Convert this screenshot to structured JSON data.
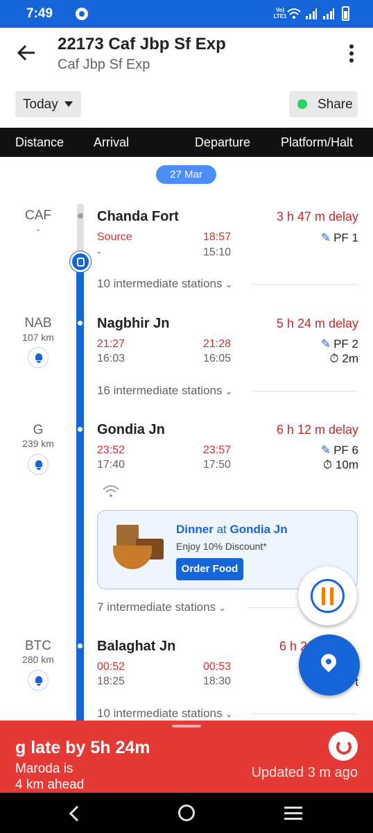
{
  "status_bar": {
    "time": "7:49",
    "volte": "Vo) LTE1"
  },
  "header": {
    "title": "22173 Caf Jbp Sf Exp",
    "subtitle": "Caf Jbp Sf Exp"
  },
  "filters": {
    "day_label": "Today",
    "share_label": "Share"
  },
  "columns": [
    "Distance",
    "Arrival",
    "Departure",
    "Platform/Halt"
  ],
  "date_pill": "27 Mar",
  "stations": [
    {
      "code": "CAF",
      "km": "-",
      "name": "Chanda Fort",
      "delay": "3 h 47 m delay",
      "arr_actual": "Source",
      "dep_actual": "18:57",
      "arr_sched": "-",
      "dep_sched": "15:10",
      "platform": "PF 1",
      "halt": ""
    },
    {
      "code": "NAB",
      "km": "107 km",
      "name": "Nagbhir Jn",
      "delay": "5 h 24 m delay",
      "arr_actual": "21:27",
      "dep_actual": "21:28",
      "arr_sched": "16:03",
      "dep_sched": "16:05",
      "platform": "PF 2",
      "halt": "2m"
    },
    {
      "code": "G",
      "km": "239 km",
      "name": "Gondia Jn",
      "delay": "6 h 12 m delay",
      "arr_actual": "23:52",
      "dep_actual": "23:57",
      "arr_sched": "17:40",
      "dep_sched": "17:50",
      "platform": "PF 6",
      "halt": "10m"
    },
    {
      "code": "BTC",
      "km": "280 km",
      "name": "Balaghat Jn",
      "delay": "6 h 2",
      "arr_actual": "00:52",
      "dep_actual": "00:53",
      "arr_sched": "18:25",
      "dep_sched": "18:30",
      "platform": "",
      "halt": "t"
    }
  ],
  "intermediates": [
    "10 intermediate stations",
    "16 intermediate stations",
    "7 intermediate stations",
    "10 intermediate stations"
  ],
  "food_card": {
    "meal": "Dinner",
    "at": "at",
    "station": "Gondia Jn",
    "offer": "Enjoy 10% Discount*",
    "button": "Order Food"
  },
  "live_status": {
    "headline": "g late by 5h 24m",
    "line1": "Maroda is",
    "line2": "4 km ahead",
    "updated": "Updated 3 m  ago"
  },
  "colors": {
    "primary": "#1565d8",
    "delay_red": "#c62828",
    "banner_red": "#e53935"
  },
  "icons": [
    "back-arrow-icon",
    "more-vert-icon",
    "dropdown-caret-icon",
    "whatsapp-icon",
    "train-icon",
    "bell-icon",
    "edit-pencil-icon",
    "timer-icon",
    "chevron-down-icon",
    "wifi-icon",
    "food-utensils-icon",
    "location-pin-icon",
    "refresh-icon"
  ]
}
